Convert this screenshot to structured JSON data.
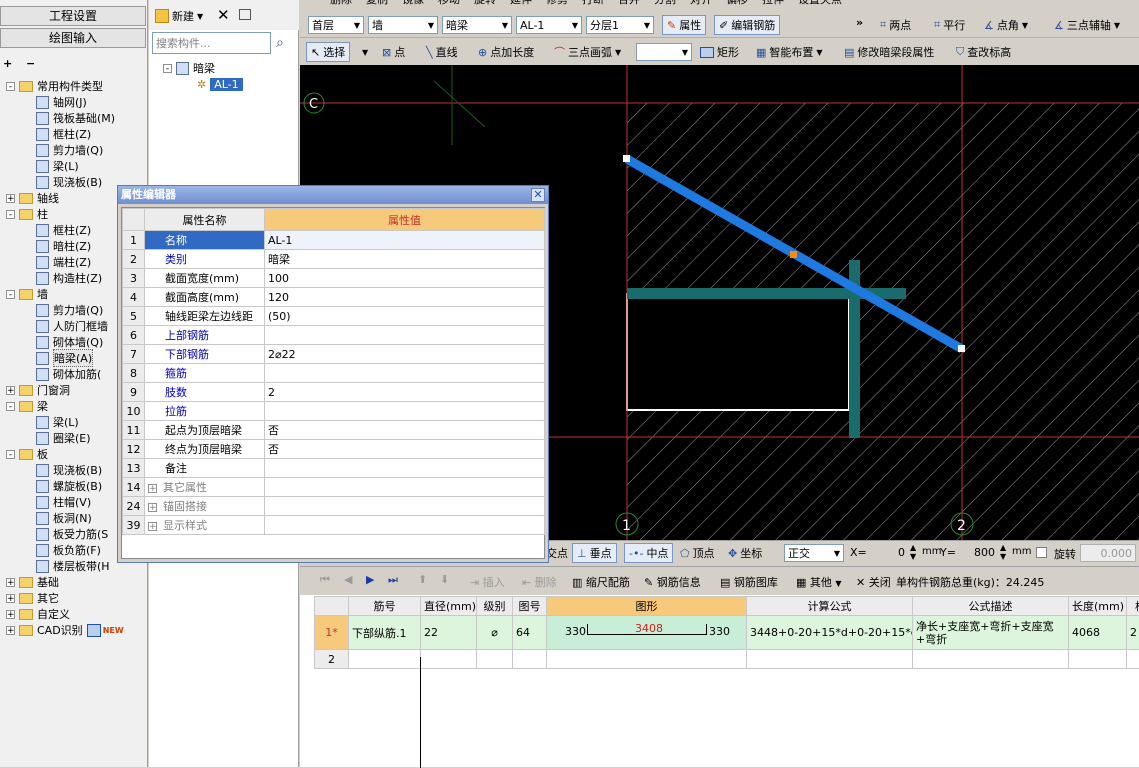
{
  "left_panel": {
    "tab_project": "工程设置",
    "tab_drawing": "绘图输入",
    "tree": [
      {
        "label": "常用构件类型",
        "level": 0,
        "type": "folder",
        "exp": "-"
      },
      {
        "label": "轴网(J)",
        "level": 1,
        "type": "item"
      },
      {
        "label": "筏板基础(M)",
        "level": 1,
        "type": "item"
      },
      {
        "label": "框柱(Z)",
        "level": 1,
        "type": "item"
      },
      {
        "label": "剪力墙(Q)",
        "level": 1,
        "type": "item"
      },
      {
        "label": "梁(L)",
        "level": 1,
        "type": "item"
      },
      {
        "label": "现浇板(B)",
        "level": 1,
        "type": "item"
      },
      {
        "label": "轴线",
        "level": 0,
        "type": "folder",
        "exp": "+"
      },
      {
        "label": "柱",
        "level": 0,
        "type": "folder",
        "exp": "-"
      },
      {
        "label": "框柱(Z)",
        "level": 1,
        "type": "item"
      },
      {
        "label": "暗柱(Z)",
        "level": 1,
        "type": "item"
      },
      {
        "label": "端柱(Z)",
        "level": 1,
        "type": "item"
      },
      {
        "label": "构造柱(Z)",
        "level": 1,
        "type": "item"
      },
      {
        "label": "墙",
        "level": 0,
        "type": "folder",
        "exp": "-"
      },
      {
        "label": "剪力墙(Q)",
        "level": 1,
        "type": "item"
      },
      {
        "label": "人防门框墙",
        "level": 1,
        "type": "item"
      },
      {
        "label": "砌体墙(Q)",
        "level": 1,
        "type": "item"
      },
      {
        "label": "暗梁(A)",
        "level": 1,
        "type": "item"
      },
      {
        "label": "砌体加筋(",
        "level": 1,
        "type": "item"
      },
      {
        "label": "门窗洞",
        "level": 0,
        "type": "folder",
        "exp": "+"
      },
      {
        "label": "梁",
        "level": 0,
        "type": "folder",
        "exp": "-"
      },
      {
        "label": "梁(L)",
        "level": 1,
        "type": "item"
      },
      {
        "label": "圈梁(E)",
        "level": 1,
        "type": "item"
      },
      {
        "label": "板",
        "level": 0,
        "type": "folder",
        "exp": "-"
      },
      {
        "label": "现浇板(B)",
        "level": 1,
        "type": "item"
      },
      {
        "label": "螺旋板(B)",
        "level": 1,
        "type": "item"
      },
      {
        "label": "柱帽(V)",
        "level": 1,
        "type": "item"
      },
      {
        "label": "板洞(N)",
        "level": 1,
        "type": "item"
      },
      {
        "label": "板受力筋(S",
        "level": 1,
        "type": "item"
      },
      {
        "label": "板负筋(F)",
        "level": 1,
        "type": "item"
      },
      {
        "label": "楼层板带(H",
        "level": 1,
        "type": "item"
      },
      {
        "label": "基础",
        "level": 0,
        "type": "folder",
        "exp": "+"
      },
      {
        "label": "其它",
        "level": 0,
        "type": "folder",
        "exp": "+"
      },
      {
        "label": "自定义",
        "level": 0,
        "type": "folder",
        "exp": "+"
      },
      {
        "label": "CAD识别",
        "level": 0,
        "type": "folder",
        "exp": "+",
        "badge": "NEW"
      }
    ]
  },
  "component_panel": {
    "new_label": "新建",
    "search_placeholder": "搜索构件...",
    "root": "暗梁",
    "child": "AL-1"
  },
  "toolbar_top": {
    "floor": "首层",
    "category": "墙",
    "type": "暗梁",
    "name": "AL-1",
    "layer": "分层1",
    "prop_btn": "属性",
    "edit_rebar_btn": "编辑钢筋",
    "two_point": "两点",
    "parallel": "平行",
    "point_angle": "点角",
    "three_point_axis": "三点辅轴",
    "partial_top": [
      "删除",
      "复制",
      "镜像",
      "移动",
      "旋转",
      "延伸",
      "修剪",
      "打断",
      "合并",
      "分割",
      "对齐",
      "偏移",
      "拉伸",
      "设置夹点"
    ]
  },
  "toolbar_draw": {
    "select": "选择",
    "point": "点",
    "line": "直线",
    "point_length": "点加长度",
    "three_arc": "三点画弧",
    "rect": "矩形",
    "smart_layout": "智能布置",
    "modify_beam": "修改暗梁段属性",
    "check_elev": "查改标高"
  },
  "canvas": {
    "axis_c": "C",
    "axis_1": "1",
    "axis_2": "2"
  },
  "status_bar": {
    "snap_partial": "交点",
    "perpendicular": "垂点",
    "midpoint": "中点",
    "vertex": "顶点",
    "coordinate": "坐标",
    "mode": "正交",
    "x_label": "X=",
    "x_value": "0",
    "y_label": "Y=",
    "y_value": "800",
    "unit": "mm",
    "rotate": "旋转",
    "rotate_value": "0.000"
  },
  "prop_editor": {
    "title": "属性编辑器",
    "col_name": "属性名称",
    "col_value": "属性值",
    "rows": [
      {
        "no": "1",
        "name": "名称",
        "value": "AL-1",
        "style": "blue",
        "selected": true
      },
      {
        "no": "2",
        "name": "类别",
        "value": "暗梁",
        "style": "blue"
      },
      {
        "no": "3",
        "name": "截面宽度(mm)",
        "value": "100",
        "style": "black"
      },
      {
        "no": "4",
        "name": "截面高度(mm)",
        "value": "120",
        "style": "black"
      },
      {
        "no": "5",
        "name": "轴线距梁左边线距",
        "value": "(50)",
        "style": "black"
      },
      {
        "no": "6",
        "name": "上部钢筋",
        "value": "",
        "style": "blue"
      },
      {
        "no": "7",
        "name": "下部钢筋",
        "value": "2⌀22",
        "style": "blue"
      },
      {
        "no": "8",
        "name": "箍筋",
        "value": "",
        "style": "blue"
      },
      {
        "no": "9",
        "name": "肢数",
        "value": "2",
        "style": "blue"
      },
      {
        "no": "10",
        "name": "拉筋",
        "value": "",
        "style": "blue"
      },
      {
        "no": "11",
        "name": "起点为顶层暗梁",
        "value": "否",
        "style": "black"
      },
      {
        "no": "12",
        "name": "终点为顶层暗梁",
        "value": "否",
        "style": "black"
      },
      {
        "no": "13",
        "name": "备注",
        "value": "",
        "style": "black"
      },
      {
        "no": "14",
        "name": "其它属性",
        "value": "",
        "style": "gray",
        "expander": true
      },
      {
        "no": "24",
        "name": "锚固搭接",
        "value": "",
        "style": "gray",
        "expander": true
      },
      {
        "no": "39",
        "name": "显示样式",
        "value": "",
        "style": "gray",
        "expander": true
      }
    ]
  },
  "rebar_panel": {
    "insert": "插入",
    "delete": "删除",
    "scale_rebar": "缩尺配筋",
    "rebar_info": "钢筋信息",
    "rebar_library": "钢筋图库",
    "other": "其他",
    "close": "关闭",
    "total_label": "单构件钢筋总重(kg)：24.245",
    "headers": [
      "筋号",
      "直径(mm)",
      "级别",
      "图号",
      "图形",
      "计算公式",
      "公式描述",
      "长度(mm)",
      "根"
    ],
    "rows": [
      {
        "no": "1*",
        "name": "下部纵筋.1",
        "dia": "22",
        "grade": "⌀",
        "fig": "64",
        "shape_left": "330",
        "shape_mid": "3408",
        "shape_right": "330",
        "formula": "3448+0-20+15*d+0-20+15*d",
        "desc": "净长+支座宽+弯折+支座宽+弯折",
        "length": "4068",
        "count": "2"
      },
      {
        "no": "2",
        "name": "",
        "dia": "",
        "grade": "",
        "fig": "",
        "shape_left": "",
        "shape_mid": "",
        "shape_right": "",
        "formula": "",
        "desc": "",
        "length": "",
        "count": ""
      }
    ]
  }
}
